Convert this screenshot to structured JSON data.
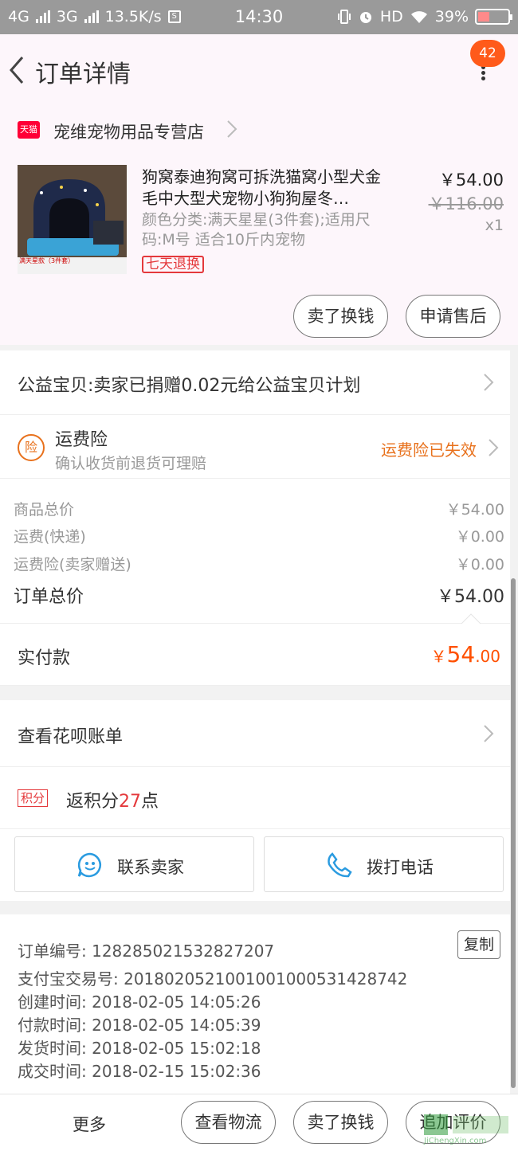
{
  "status_bar": {
    "network_1": "4G",
    "network_2": "3G",
    "speed": "13.5K/s",
    "time": "14:30",
    "hd": "HD",
    "battery": "39%"
  },
  "nav": {
    "title": "订单详情",
    "badge": "42"
  },
  "store": {
    "logo_text": "天猫",
    "name": "宠维宠物用品专营店"
  },
  "product": {
    "title": "狗窝泰迪狗窝可拆洗猫窝小型犬金毛中大型犬宠物小狗狗屋冬…",
    "sku": "颜色分类:满天星星(3件套);适用尺码:M号 适合10斤内宠物",
    "tag": "七天退换",
    "price": "￥54.00",
    "original_price": "￥116.00",
    "quantity": "x1",
    "image_caption": "满天星款（3件套）"
  },
  "product_actions": {
    "resell": "卖了换钱",
    "after_sale": "申请售后"
  },
  "charity": {
    "text": "公益宝贝:卖家已捐赠0.02元给公益宝贝计划"
  },
  "insurance": {
    "icon_text": "险",
    "title": "运费险",
    "subtitle": "确认收货前退货可理赔",
    "status": "运费险已失效"
  },
  "fees": {
    "items": [
      {
        "label": "商品总价",
        "value": "￥54.00"
      },
      {
        "label": "运费(快递)",
        "value": "￥0.00"
      },
      {
        "label": "运费险(卖家赠送)",
        "value": "￥0.00"
      }
    ],
    "total_label": "订单总价",
    "total_value": "￥54.00"
  },
  "payment": {
    "label": "实付款",
    "currency": "￥",
    "amount_int": "54",
    "amount_dec": ".00"
  },
  "huabei": {
    "label": "查看花呗账单"
  },
  "points": {
    "icon_text": "积分",
    "prefix": "返积分",
    "number": "27",
    "suffix": "点"
  },
  "contact": {
    "seller": "联系卖家",
    "phone": "拨打电话"
  },
  "order_info": {
    "lines": [
      "订单编号: 128285021532827207",
      "支付宝交易号: 2018020521001001000531428742",
      "创建时间: 2018-02-05 14:05:26",
      "付款时间: 2018-02-05 14:05:39",
      "发货时间: 2018-02-05 15:02:18",
      "成交时间: 2018-02-15 15:02:36"
    ],
    "copy_label": "复制"
  },
  "bottom_bar": {
    "more": "更多",
    "logistics": "查看物流",
    "resell": "卖了换钱",
    "review": "追加评价"
  },
  "watermark": "JiChengXin.com",
  "colors": {
    "accent_orange": "#ff5000",
    "tmall_red": "#ff0036",
    "insurance_orange": "#e8711c",
    "icon_blue": "#2a9be0"
  }
}
